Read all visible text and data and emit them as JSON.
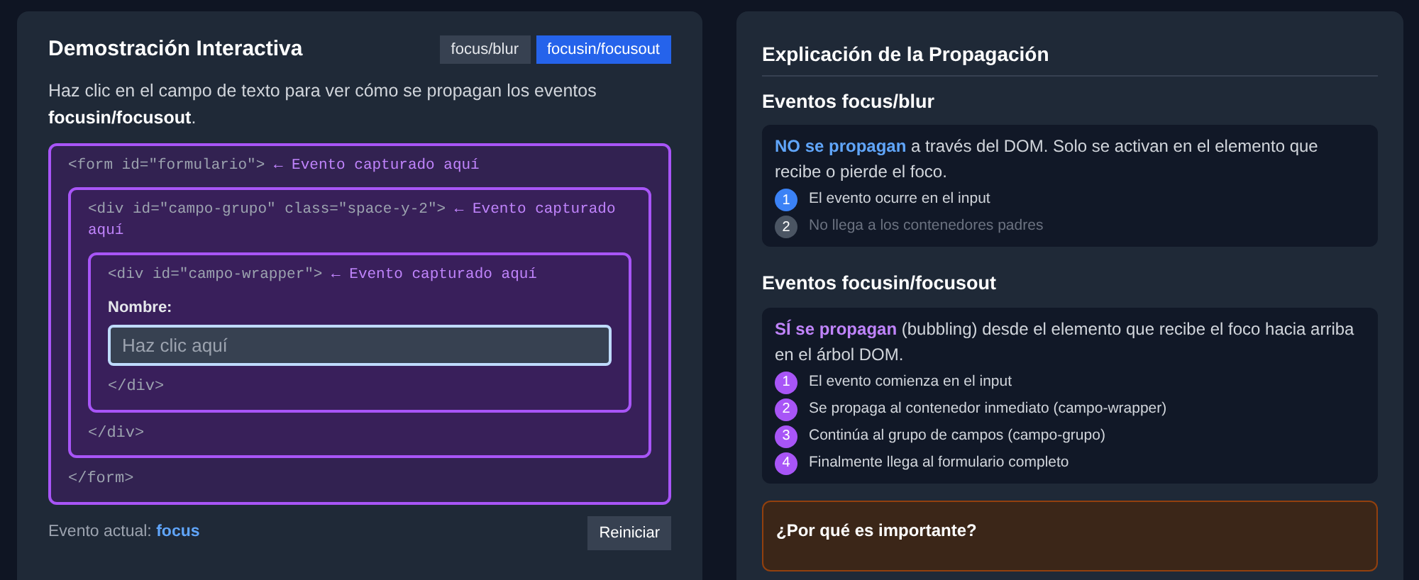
{
  "demo": {
    "title": "Demostración Interactiva",
    "tabs": [
      {
        "label": "focus/blur",
        "selected": false
      },
      {
        "label": "focusin/focusout",
        "selected": true
      }
    ],
    "intro": "Haz clic en el campo de texto para ver cómo se propagan los eventos **focusin/focusout**.",
    "tree": {
      "open": "<form id=\"formulario\">",
      "note": "← Evento capturado aquí",
      "captured": true,
      "close": "</form>",
      "children": [
        {
          "open": "<div id=\"campo-grupo\" class=\"space-y-2\">",
          "note": "← Evento capturado aquí",
          "captured": true,
          "close": "</div>",
          "children": [
            {
              "open": "<div id=\"campo-wrapper\">",
              "note": "← Evento capturado aquí",
              "captured": true,
              "close": "</div>",
              "field": {
                "label": "Nombre:",
                "placeholder": "Haz clic aquí",
                "focused": true
              }
            }
          ]
        }
      ]
    },
    "status_label": "Evento actual:",
    "status_value": "focus",
    "reset_button": "Reiniciar"
  },
  "explanation": {
    "title": "Explicación de la Propagación",
    "sections": [
      {
        "heading": "Eventos focus/blur",
        "kind": "blue",
        "lead": "NO se propagan",
        "text": " a través del DOM. Solo se activan en el elemento que recibe o pierde el foco.",
        "steps": [
          {
            "number": "1",
            "label": "El evento ocurre en el input",
            "active": true
          },
          {
            "number": "2",
            "label": "No llega a los contenedores padres",
            "active": false
          }
        ]
      },
      {
        "heading": "Eventos focusin/focusout",
        "kind": "purple",
        "lead": "SÍ se propagan",
        "text": " (bubbling) desde el elemento que recibe el foco hacia arriba en el árbol DOM.",
        "steps": [
          {
            "number": "1",
            "label": "El evento comienza en el input",
            "active": true
          },
          {
            "number": "2",
            "label": "Se propaga al contenedor inmediato (campo-wrapper)",
            "active": true
          },
          {
            "number": "3",
            "label": "Continúa al grupo de campos (campo-grupo)",
            "active": true
          },
          {
            "number": "4",
            "label": "Finalmente llega al formulario completo",
            "active": true
          }
        ]
      }
    ],
    "note_title": "¿Por qué es importante?"
  }
}
